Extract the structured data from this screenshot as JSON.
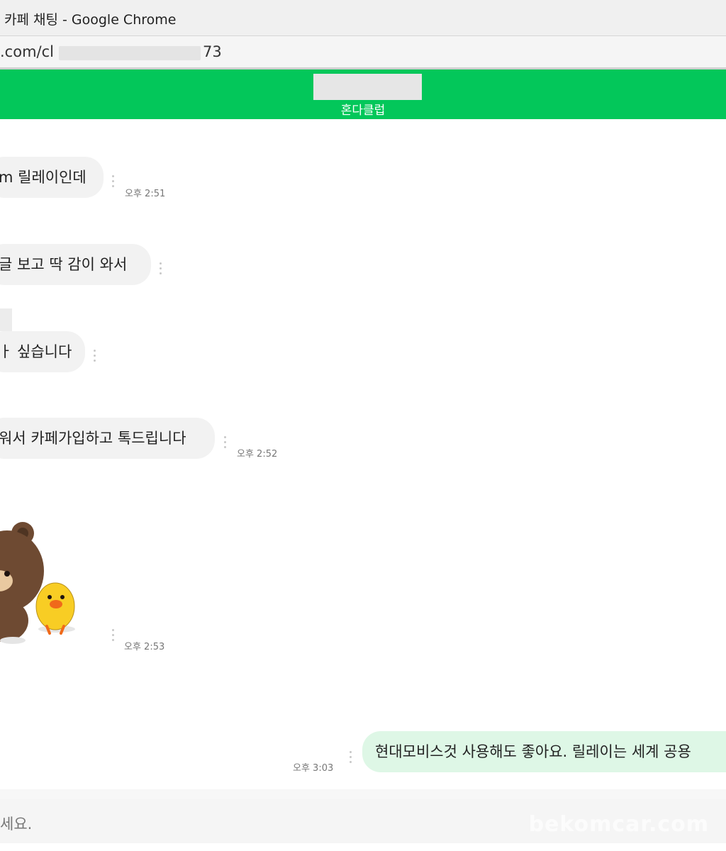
{
  "window": {
    "title": "카페 채팅 - Google Chrome"
  },
  "address_bar": {
    "url_start": ".com/cl",
    "url_end": "73"
  },
  "chat_header": {
    "cafe_name": "혼다클럽"
  },
  "messages": [
    {
      "text": "m 릴레이인데",
      "time": "오후 2:51",
      "sender": "other"
    },
    {
      "text": "글 보고 딱 감이 와서",
      "time": "",
      "sender": "other"
    },
    {
      "text": "ㅏ 싶습니다",
      "time": "",
      "sender": "other"
    },
    {
      "text": "워서 카페가입하고 톡드립니다",
      "time": "오후 2:52",
      "sender": "other"
    },
    {
      "text": "",
      "time": "오후 2:53",
      "sender": "other",
      "sticker": "bear-and-chick-sticker"
    },
    {
      "text": "현대모비스것 사용해도 좋아요. 릴레이는 세계 공용",
      "time": "오후 3:03",
      "sender": "me"
    }
  ],
  "input": {
    "placeholder": "세요."
  },
  "watermark": "bekomcar.com",
  "colors": {
    "header_green": "#03c75a",
    "my_bubble": "#def7e6",
    "other_bubble": "#f2f2f2"
  }
}
